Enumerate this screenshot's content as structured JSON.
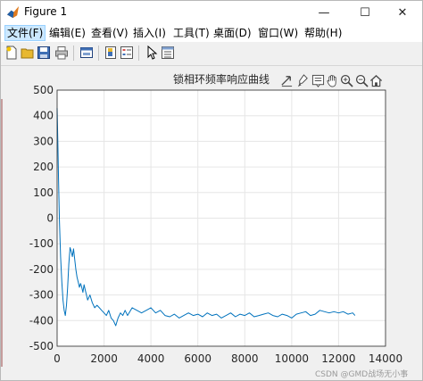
{
  "window": {
    "title": "Figure 1",
    "controls": {
      "minimize": "—",
      "maximize": "☐",
      "close": "✕"
    }
  },
  "menu": [
    "文件(F)",
    "编辑(E)",
    "查看(V)",
    "插入(I)",
    "工具(T)",
    "桌面(D)",
    "窗口(W)",
    "帮助(H)"
  ],
  "toolbar_icons": [
    "new-figure-icon",
    "open-icon",
    "save-icon",
    "print-icon",
    "link-icon",
    "colorbar-icon",
    "legend-icon",
    "property-inspector-icon"
  ],
  "axes_toolbar_icons": [
    "export-icon",
    "brush-icon",
    "datatip-icon",
    "pan-icon",
    "zoom-in-icon",
    "zoom-out-icon",
    "home-icon"
  ],
  "chart_data": {
    "type": "line",
    "title": "锁相环频率响应曲线",
    "xlabel": "",
    "ylabel": "",
    "xlim": [
      0,
      14000
    ],
    "ylim": [
      -500,
      500
    ],
    "xticks": [
      "0",
      "2000",
      "4000",
      "6000",
      "8000",
      "10000",
      "12000",
      "14000"
    ],
    "yticks": [
      "500",
      "400",
      "300",
      "200",
      "100",
      "0",
      "-100",
      "-200",
      "-300",
      "-400",
      "-500"
    ],
    "grid": true,
    "line_color": "#0072bd",
    "series": [
      {
        "x": [
          0,
          30,
          60,
          100,
          150,
          200,
          250,
          300,
          350,
          400,
          450,
          500,
          550,
          600,
          650,
          700,
          750,
          800,
          850,
          900,
          950,
          1000,
          1050,
          1100,
          1150,
          1200,
          1250,
          1300,
          1400,
          1500,
          1600,
          1700,
          1800,
          1900,
          2000,
          2100,
          2200,
          2300,
          2400,
          2500,
          2600,
          2700,
          2800,
          2900,
          3000,
          3200,
          3400,
          3600,
          3800,
          4000,
          4200,
          4400,
          4600,
          4800,
          5000,
          5200,
          5400,
          5600,
          5800,
          6000,
          6200,
          6400,
          6600,
          6800,
          7000,
          7200,
          7400,
          7600,
          7800,
          8000,
          8200,
          8400,
          8600,
          8800,
          9000,
          9200,
          9400,
          9600,
          9800,
          10000,
          10200,
          10400,
          10600,
          10800,
          11000,
          11200,
          11400,
          11600,
          11800,
          12000,
          12200,
          12400,
          12600,
          12700
        ],
        "y": [
          430,
          300,
          150,
          -10,
          -150,
          -250,
          -320,
          -360,
          -380,
          -340,
          -270,
          -180,
          -115,
          -130,
          -150,
          -120,
          -160,
          -200,
          -230,
          -250,
          -270,
          -255,
          -270,
          -290,
          -260,
          -280,
          -300,
          -320,
          -300,
          -330,
          -350,
          -340,
          -350,
          -360,
          -370,
          -380,
          -360,
          -390,
          -400,
          -420,
          -390,
          -370,
          -380,
          -360,
          -380,
          -350,
          -360,
          -370,
          -360,
          -350,
          -370,
          -360,
          -380,
          -385,
          -375,
          -390,
          -380,
          -370,
          -380,
          -375,
          -385,
          -370,
          -380,
          -375,
          -390,
          -380,
          -370,
          -385,
          -375,
          -380,
          -370,
          -385,
          -380,
          -375,
          -370,
          -380,
          -385,
          -375,
          -380,
          -390,
          -375,
          -370,
          -365,
          -380,
          -375,
          -360,
          -365,
          -370,
          -365,
          -370,
          -365,
          -375,
          -370,
          -380
        ]
      }
    ]
  },
  "watermark": "CSDN @GMD战场无小事"
}
